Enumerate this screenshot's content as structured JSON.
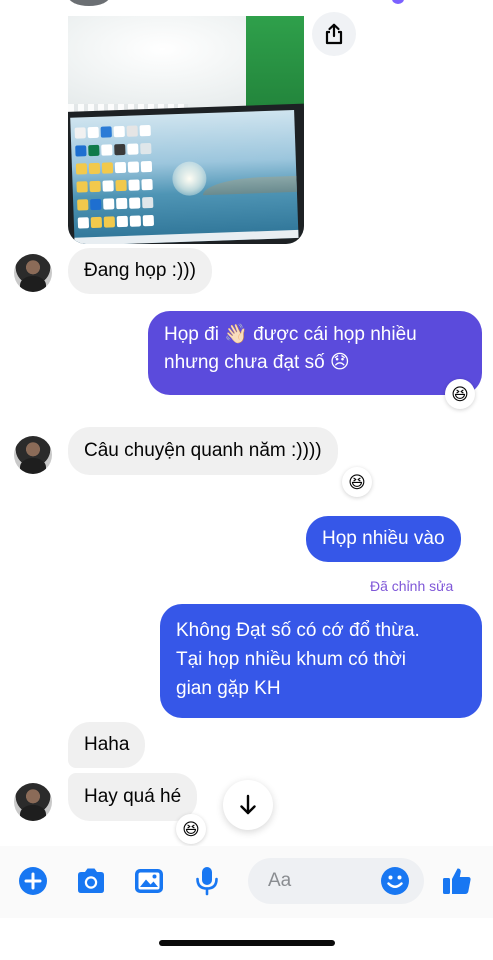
{
  "colors": {
    "incoming_bubble": "#f0f0f0",
    "outgoing_purple": "#5b4bdc",
    "outgoing_blue": "#3657e8",
    "accent_blue": "#1877f2",
    "edited_label": "#7f57d8"
  },
  "icons": {
    "share": "share-icon",
    "scroll_down": "arrow-down-icon",
    "add": "plus-circle-icon",
    "camera": "camera-icon",
    "gallery": "image-icon",
    "mic": "microphone-icon",
    "emoji": "smiley-icon",
    "like": "thumbs-up-icon"
  },
  "messages": [
    {
      "sender": "contact",
      "type": "image"
    },
    {
      "sender": "contact",
      "text": "Đang họp :)))"
    },
    {
      "sender": "me",
      "lines": [
        "Họp đi 👋🏻 được cái họp nhiều",
        "nhưng chưa đạt số 😞"
      ],
      "reaction": "😆"
    },
    {
      "sender": "contact",
      "text": "Câu chuyện quanh năm :))))",
      "reaction": "😆"
    },
    {
      "sender": "me",
      "text": "Họp nhiều vào"
    },
    {
      "sender": "me",
      "edited_label": "Đã chỉnh sửa",
      "lines": [
        "Không Đạt số có cớ đổ thừa.",
        "Tại họp nhiều khum có thời",
        "gian gặp KH"
      ]
    },
    {
      "sender": "contact",
      "text": "Haha"
    },
    {
      "sender": "contact",
      "text": "Hay quá hé",
      "reaction": "😆"
    }
  ],
  "composer": {
    "placeholder": "Aa"
  }
}
